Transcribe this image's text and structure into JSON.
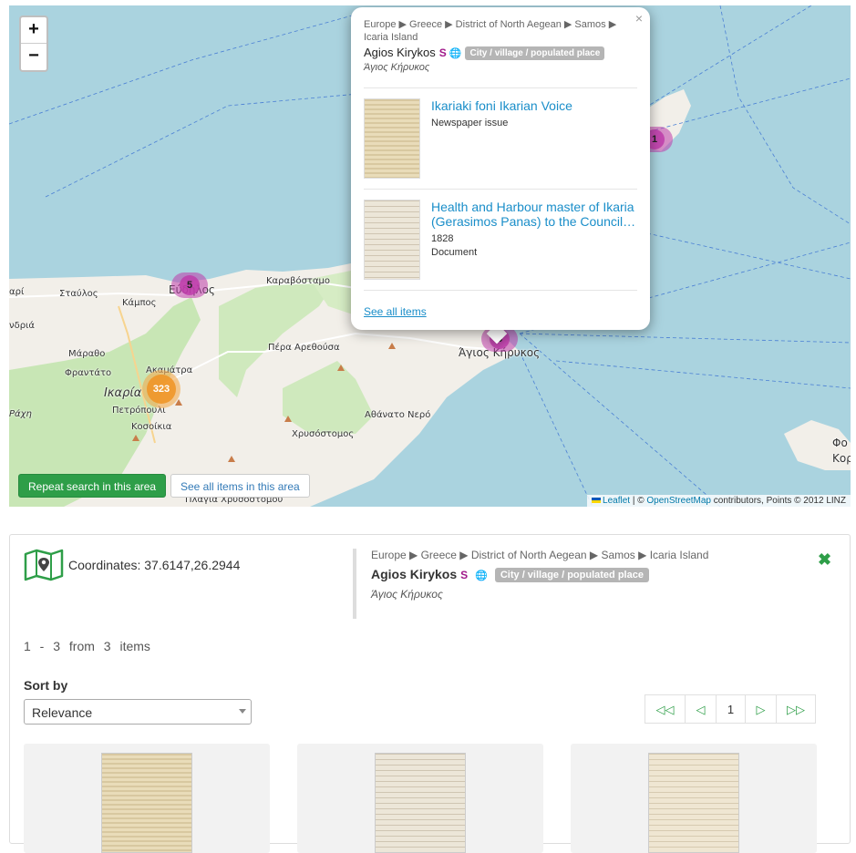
{
  "map": {
    "zoom_in": "+",
    "zoom_out": "−",
    "labels": [
      "Σταύλος",
      "Κάμπος",
      "Εύδηλος",
      "Καραβόσταμο",
      "Πέρα Αρεθούσα",
      "Μάραθο",
      "Ακαμάτρα",
      "Φραντάτο",
      "Ικαρία",
      "Πετρόπουλι",
      "Ράχη",
      "Κοσοίκια",
      "Χρυσόστομος",
      "Αθάνατο Νερό",
      "Άγιος Κήρυκος",
      "Πλαγιά Χρυσοστόμου",
      "Φο",
      "Κορ",
      "αρί",
      "νδριά"
    ],
    "clusters": [
      "5",
      "323",
      "3",
      "1"
    ],
    "repeat_button": "Repeat search in this area",
    "see_all_button": "See all items in this area",
    "attribution": {
      "leaflet": "Leaflet",
      "sep": " | © ",
      "osm": "OpenStreetMap",
      "rest": " contributors, Points © 2012 LINZ"
    }
  },
  "popup": {
    "close": "×",
    "breadcrumb": "Europe ▶ Greece ▶ District of North Aegean ▶ Samos ▶ Icaria Island",
    "name": "Agios Kirykos",
    "wiki": "S",
    "globe": "🌐",
    "badge": "City / village / populated place",
    "greek": "Άγιος Κήρυκος",
    "items": [
      {
        "title": "Ikariaki foni Ikarian Voice",
        "year": "",
        "type": "Newspaper issue"
      },
      {
        "title": "Health and Harbour master of Ikaria (Gerasimos Panas) to the Council…",
        "year": "1828",
        "type": "Document"
      }
    ],
    "see_all": "See all items"
  },
  "panel": {
    "coordinates": "Coordinates: 37.6147,26.2944",
    "breadcrumb": "Europe ▶ Greece ▶ District of North Aegean ▶ Samos ▶ Icaria Island",
    "name": "Agios Kirykos",
    "wiki": "S",
    "globe": "🌐",
    "badge": "City / village / populated place",
    "greek": "Άγιος Κήρυκος",
    "close": "✖",
    "counts": "1 - 3 from 3 items",
    "sort_label": "Sort by",
    "sort_value": "Relevance",
    "pager": [
      "◁◁",
      "◁",
      "1",
      "▷",
      "▷▷"
    ]
  },
  "colors": {
    "accent_green": "#2e9e48",
    "link_blue": "#1a8ec9",
    "wiki_purple": "#a0198a",
    "badge_gray": "#b5b5b5"
  }
}
